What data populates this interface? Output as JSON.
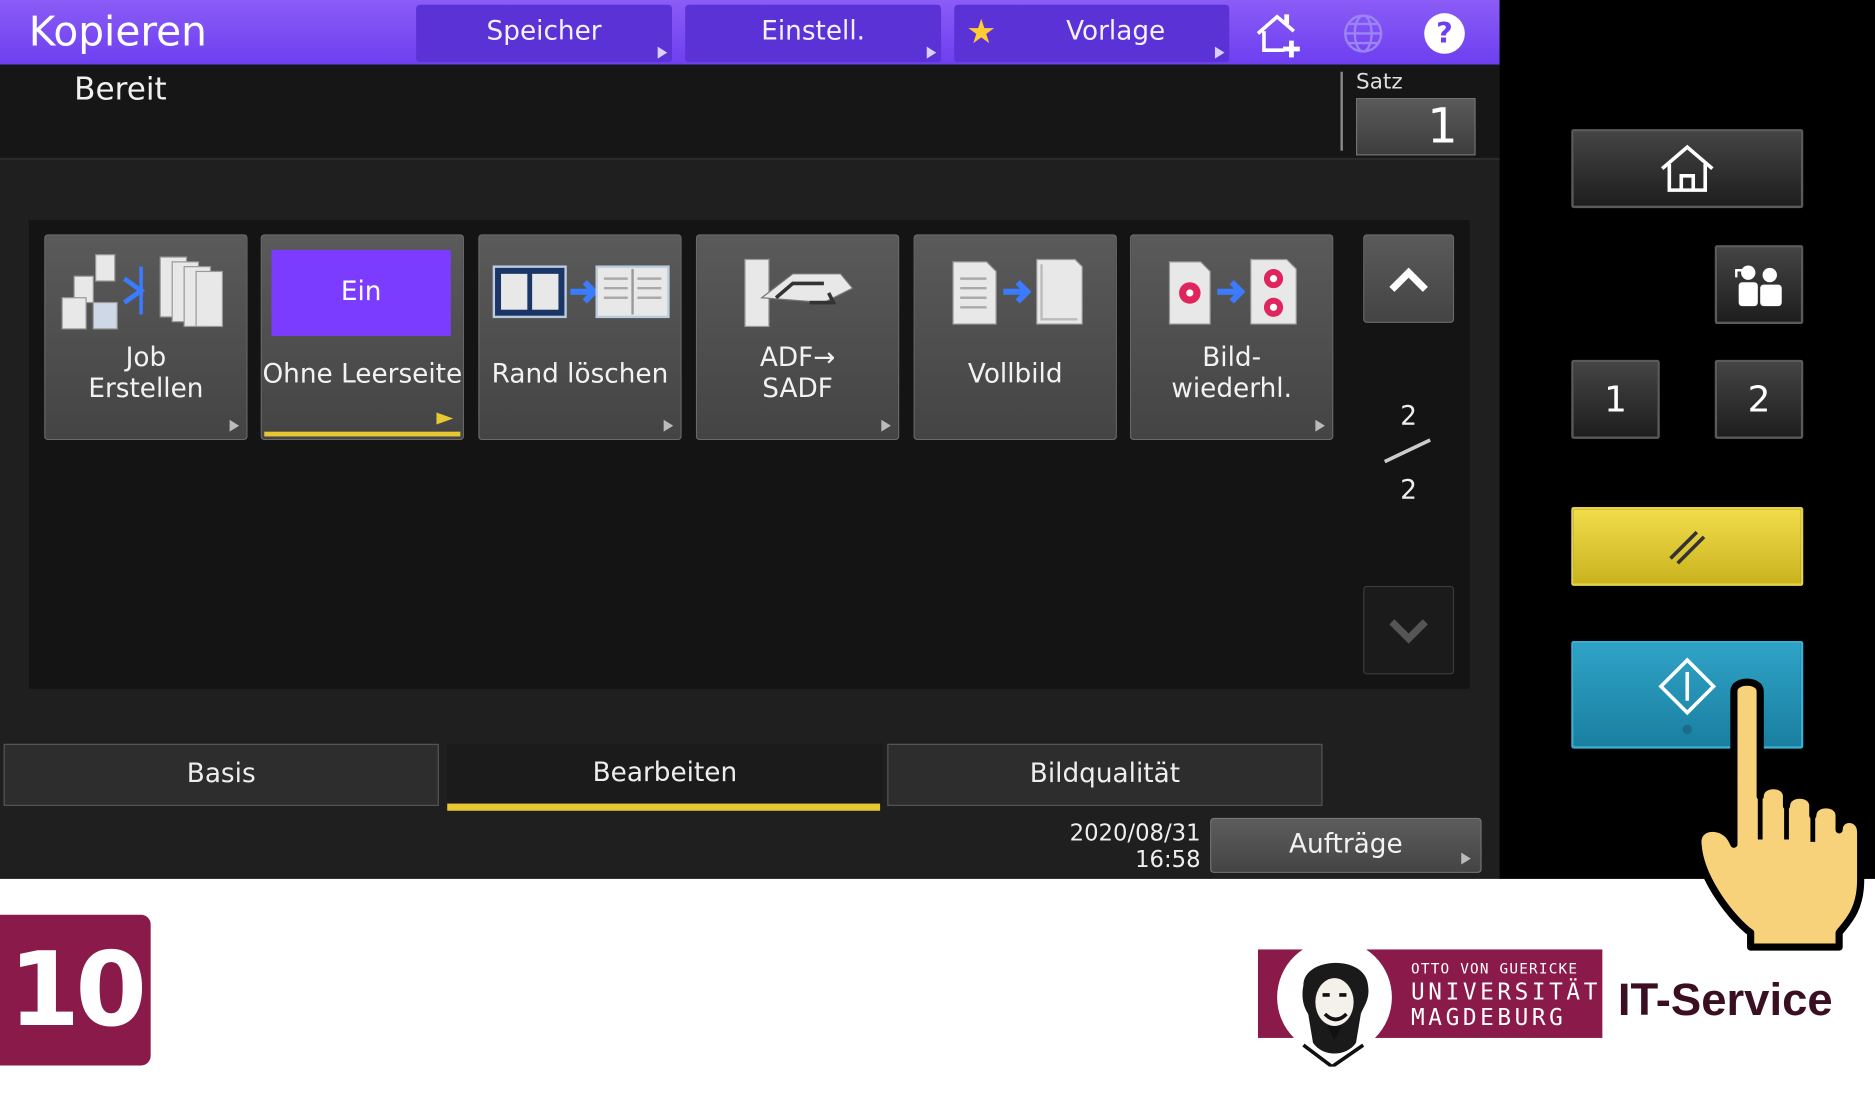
{
  "header": {
    "title": "Kopieren",
    "buttons": [
      {
        "label": "Speicher"
      },
      {
        "label": "Einstell."
      },
      {
        "label": "Vorlage"
      }
    ]
  },
  "status": {
    "text": "Bereit",
    "copies_label": "Satz",
    "copies_value": "1"
  },
  "functions": {
    "tiles": [
      {
        "label_line1": "Job",
        "label_line2": "Erstellen"
      },
      {
        "label": "Ohne Leerseite",
        "state": "Ein"
      },
      {
        "label": "Rand löschen"
      },
      {
        "label_line1": "ADF→",
        "label_line2": "SADF"
      },
      {
        "label": "Vollbild"
      },
      {
        "label_line1": "Bild-",
        "label_line2": "wiederhl."
      }
    ],
    "page_current": "2",
    "page_total": "2"
  },
  "tabs": [
    {
      "label": "Basis"
    },
    {
      "label": "Bearbeiten",
      "active": true
    },
    {
      "label": "Bildqualität"
    }
  ],
  "footer_bar": {
    "date": "2020/08/31",
    "time": "16:58",
    "jobs_label": "Aufträge"
  },
  "hardware": {
    "key1": "1",
    "key2": "2"
  },
  "caption": {
    "step_number": "10",
    "logo_line1": "OTTO VON GUERICKE",
    "logo_line2": "UNIVERSITÄT",
    "logo_line3": "MAGDEBURG",
    "service": "IT-Service"
  },
  "colors": {
    "accent": "#7c4dff",
    "highlight": "#e8c832",
    "brand": "#8a1a4a",
    "start": "#2fa3c6"
  }
}
